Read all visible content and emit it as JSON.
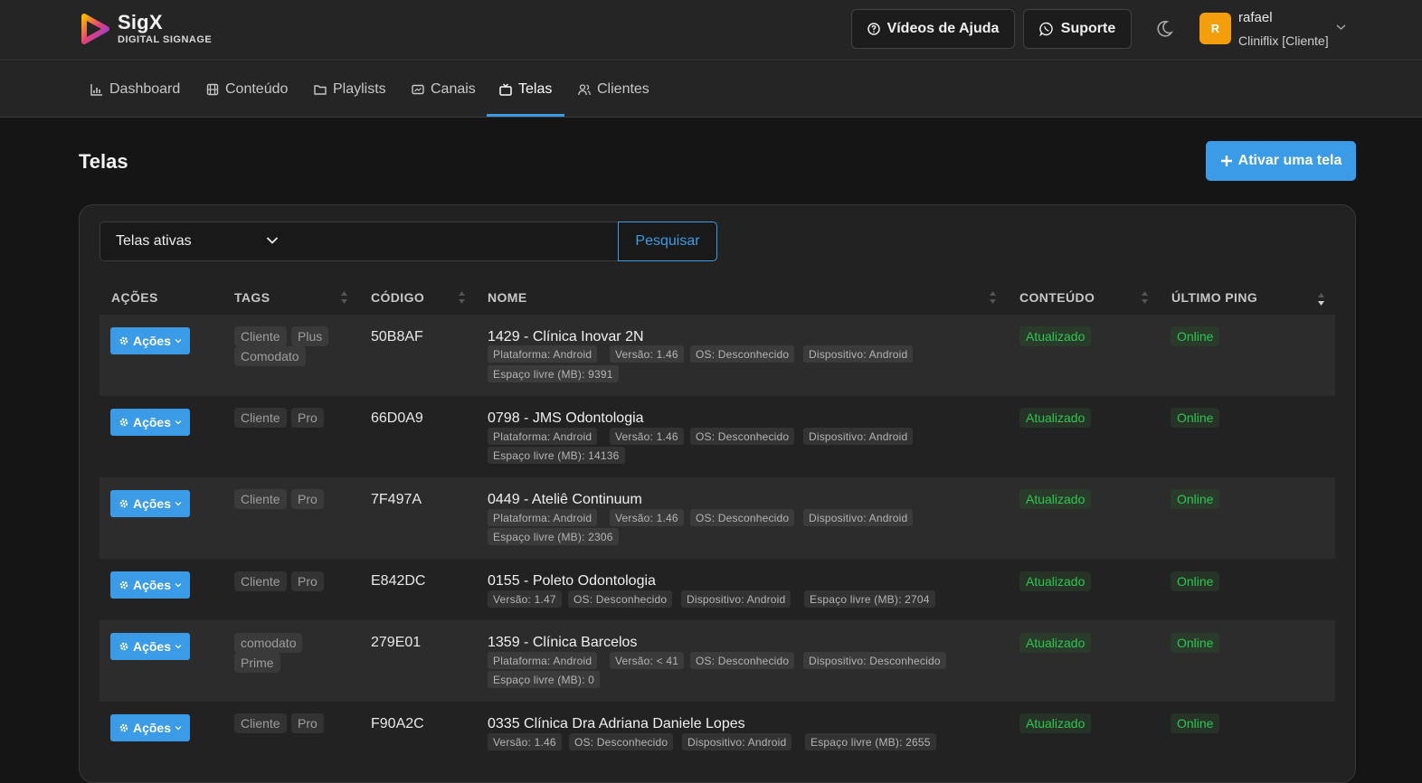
{
  "brand": {
    "title": "SigX",
    "subtitle": "DIGITAL SIGNAGE"
  },
  "header": {
    "help_label": "Vídeos de Ajuda",
    "support_label": "Suporte",
    "user_initial": "R",
    "user_name": "rafael",
    "user_org": "Cliniflix [Cliente]"
  },
  "nav": [
    {
      "label": "Dashboard",
      "icon": "chart-icon"
    },
    {
      "label": "Conteúdo",
      "icon": "film-icon"
    },
    {
      "label": "Playlists",
      "icon": "folder-icon"
    },
    {
      "label": "Canais",
      "icon": "channel-icon"
    },
    {
      "label": "Telas",
      "icon": "tv-icon",
      "active": true
    },
    {
      "label": "Clientes",
      "icon": "users-icon"
    }
  ],
  "page": {
    "title": "Telas",
    "activate_label": "Ativar uma tela"
  },
  "filters": {
    "select_value": "Telas ativas",
    "search_placeholder": "",
    "search_label": "Pesquisar"
  },
  "table": {
    "headers": [
      "AÇÕES",
      "TAGS",
      "CÓDIGO",
      "NOME",
      "CONTEÚDO",
      "ÚLTIMO PING"
    ],
    "actions_label": "Ações",
    "rows": [
      {
        "tags": [
          "Cliente",
          "Plus",
          "Comodato"
        ],
        "code": "50B8AF",
        "name": "1429 - Clínica Inovar 2N",
        "meta": [
          "Plataforma: Android",
          "Versão: 1.46",
          "OS: Desconhecido",
          "Dispositivo: Android",
          "Espaço livre (MB): 9391"
        ],
        "content": "Atualizado",
        "ping": "Online"
      },
      {
        "tags": [
          "Cliente",
          "Pro"
        ],
        "code": "66D0A9",
        "name": "0798 - JMS Odontologia",
        "meta": [
          "Plataforma: Android",
          "Versão: 1.46",
          "OS: Desconhecido",
          "Dispositivo: Android",
          "Espaço livre (MB): 14136"
        ],
        "content": "Atualizado",
        "ping": "Online"
      },
      {
        "tags": [
          "Cliente",
          "Pro"
        ],
        "code": "7F497A",
        "name": "0449 - Ateliê Continuum",
        "meta": [
          "Plataforma: Android",
          "Versão: 1.46",
          "OS: Desconhecido",
          "Dispositivo: Android",
          "Espaço livre (MB): 2306"
        ],
        "content": "Atualizado",
        "ping": "Online"
      },
      {
        "tags": [
          "Cliente",
          "Pro"
        ],
        "code": "E842DC",
        "name": "0155 - Poleto Odontologia",
        "meta": [
          "Versão: 1.47",
          "OS: Desconhecido",
          "Dispositivo: Android",
          "Espaço livre (MB): 2704"
        ],
        "content": "Atualizado",
        "ping": "Online"
      },
      {
        "tags": [
          "comodato",
          "Prime"
        ],
        "code": "279E01",
        "name": "1359 - Clínica Barcelos",
        "meta": [
          "Plataforma: Android",
          "Versão: < 41",
          "OS: Desconhecido",
          "Dispositivo: Desconhecido",
          "Espaço livre (MB): 0"
        ],
        "content": "Atualizado",
        "ping": "Online"
      },
      {
        "tags": [
          "Cliente",
          "Pro"
        ],
        "code": "F90A2C",
        "name": "0335 Clínica Dra Adriana Daniele Lopes",
        "meta": [
          "Versão: 1.46",
          "OS: Desconhecido",
          "Dispositivo: Android",
          "Espaço livre (MB): 2655"
        ],
        "content": "Atualizado",
        "ping": "Online"
      }
    ]
  },
  "colors": {
    "accent": "#3b9be6",
    "success": "#2fc552",
    "avatar": "#f59e0b"
  }
}
